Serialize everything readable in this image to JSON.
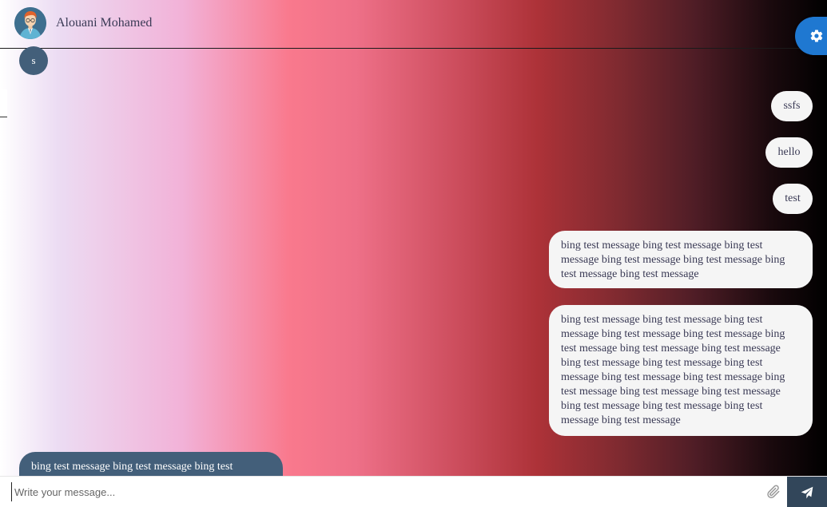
{
  "header": {
    "contact_name": "Alouani Mohamed"
  },
  "badge": {
    "initial": "s"
  },
  "messages_sent": [
    "ssfs",
    "hello",
    "test",
    "bing test message bing test message bing test message bing test message bing test message bing test message bing test message",
    "bing test message bing test message bing test message bing test message bing test message bing test message bing test message bing test message bing test message bing test message bing test message bing test message bing test message bing test message bing test message bing test message bing test message bing test message bing test message bing test message"
  ],
  "message_received": "bing test message bing test message bing test",
  "composer": {
    "placeholder": "Write your message..."
  },
  "icons": {
    "settings": "gear-icon",
    "attach": "paperclip-icon",
    "send": "paper-plane-icon",
    "avatar": "user-avatar"
  },
  "colors": {
    "accent": "#1f78d1",
    "received_bubble": "#435f7a",
    "send_button": "#32465a",
    "sent_bubble": "#f5f5f5"
  }
}
